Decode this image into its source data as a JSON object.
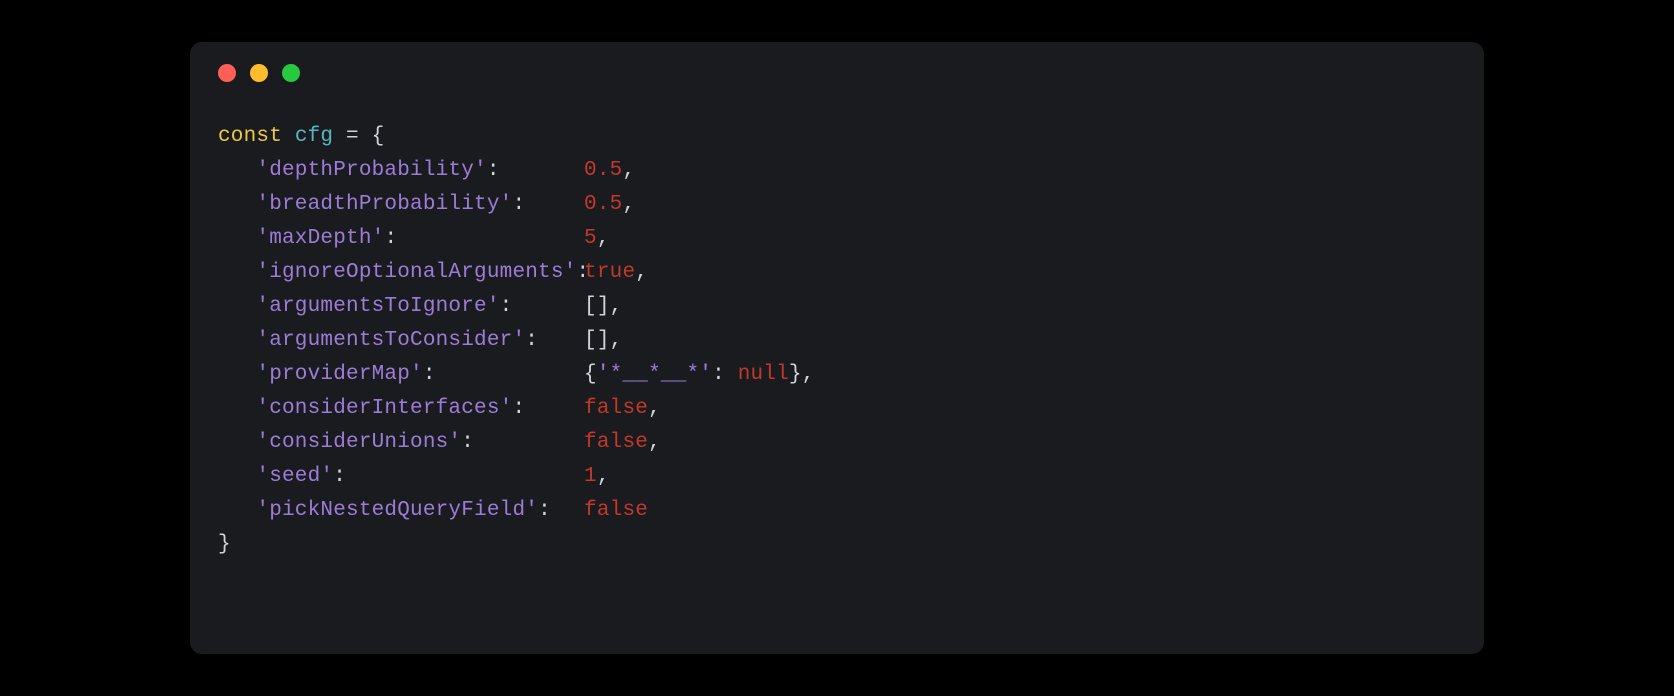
{
  "code": {
    "decl_keyword": "const",
    "decl_name": "cfg",
    "decl_eq": " = {",
    "close": "}",
    "entries": [
      {
        "key": "'depthProbability'",
        "value": "0.5",
        "vclass": "tok-number",
        "trailing": ","
      },
      {
        "key": "'breadthProbability'",
        "value": "0.5",
        "vclass": "tok-number",
        "trailing": ","
      },
      {
        "key": "'maxDepth'",
        "value": "5",
        "vclass": "tok-number",
        "trailing": ","
      },
      {
        "key": "'ignoreOptionalArguments'",
        "value": "true",
        "vclass": "tok-bool",
        "trailing": ","
      },
      {
        "key": "'argumentsToIgnore'",
        "value": "[]",
        "vclass": "tok-punct",
        "trailing": ","
      },
      {
        "key": "'argumentsToConsider'",
        "value": "[]",
        "vclass": "tok-punct",
        "trailing": ","
      },
      {
        "key": "'providerMap'",
        "value": "",
        "vclass": "",
        "trailing": "",
        "composite": "providerMap"
      },
      {
        "key": "'considerInterfaces'",
        "value": "false",
        "vclass": "tok-bool",
        "trailing": ","
      },
      {
        "key": "'considerUnions'",
        "value": "false",
        "vclass": "tok-bool",
        "trailing": ","
      },
      {
        "key": "'seed'",
        "value": "1",
        "vclass": "tok-number",
        "trailing": ","
      },
      {
        "key": "'pickNestedQueryField'",
        "value": "false",
        "vclass": "tok-bool",
        "trailing": ""
      }
    ],
    "providerMap": {
      "open": "{",
      "innerKey": "'*__*__*'",
      "colon": ": ",
      "innerVal": "null",
      "close": "},"
    }
  }
}
